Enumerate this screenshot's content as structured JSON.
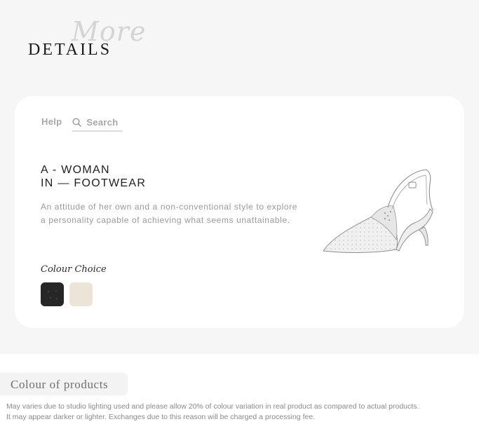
{
  "heading": {
    "script": "More",
    "main": "DETAILS"
  },
  "nav": {
    "help": "Help",
    "search": "Search"
  },
  "product": {
    "title_line1": "A - WOMAN",
    "title_line2": "IN — FOOTWEAR",
    "description_line1": "An attitude of her own and a non-conventional style to explore",
    "description_line2": "a personality capable of achieving what seems unattainable.",
    "colour_choice_label": "Colour Choice",
    "swatches": [
      {
        "name": "black",
        "color": "#262626"
      },
      {
        "name": "beige",
        "color": "#ece4d6"
      }
    ]
  },
  "colour_section": {
    "title": "Colour of products",
    "disclaimer_line1": "May varies due to studio lighting used and please allow 20% of colour variation in real product as compared to actual products.",
    "disclaimer_line2": "It may appear darker or lighter. Exchanges due to this reason will be charged a processing fee."
  },
  "icons": {
    "search": "search-icon",
    "product_image": "slingback-shoe-illustration"
  }
}
